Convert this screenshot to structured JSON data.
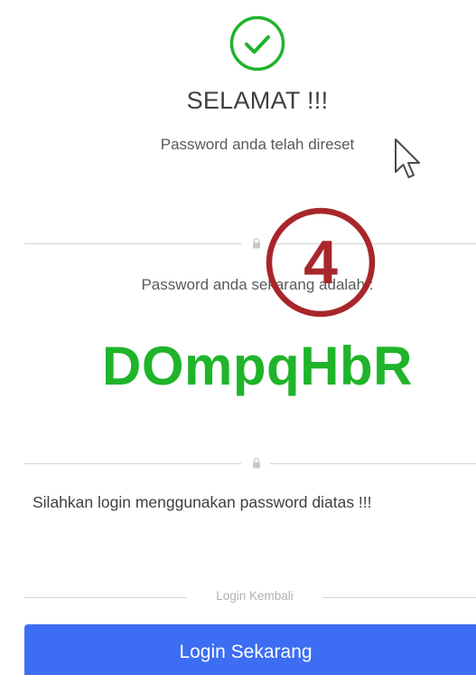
{
  "success": {
    "icon": "check-circle-icon",
    "title": "SELAMAT !!!",
    "subtitle": "Password anda telah direset"
  },
  "reset_result": {
    "label": "Password anda sekarang adalah :",
    "new_password": "DOmpqHbR",
    "instruction": "Silahkan login menggunakan password diatas !!!"
  },
  "annotation": {
    "step_number": "4"
  },
  "login": {
    "divider_text": "Login Kembali",
    "button_label": "Login Sekarang"
  },
  "colors": {
    "success_green": "#1fb42a",
    "password_green": "#1fb42a",
    "button_blue": "#3d6df2",
    "annotation_red": "#a8262b"
  }
}
